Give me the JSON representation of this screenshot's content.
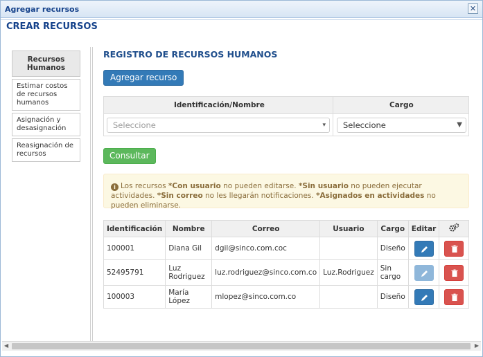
{
  "window": {
    "title": "Agregar recursos",
    "close_glyph": "✕"
  },
  "heading": "CREAR RECURSOS",
  "sidebar": {
    "items": [
      {
        "label": "Recursos Humanos",
        "active": true
      },
      {
        "label": "Estimar costos de recursos humanos",
        "active": false
      },
      {
        "label": "Asignación y desasignación",
        "active": false
      },
      {
        "label": "Reasignación de recursos",
        "active": false
      }
    ]
  },
  "main": {
    "section_title": "REGISTRO DE RECURSOS HUMANOS",
    "add_button": "Agregar recurso",
    "filter": {
      "col_id_name": "Identificación/Nombre",
      "col_cargo": "Cargo",
      "id_select_placeholder": "Seleccione",
      "cargo_select_value": "Seleccione"
    },
    "consult_button": "Consultar",
    "alert": {
      "p1": "Los recursos ",
      "b1": "*Con usuario",
      "p2": " no pueden editarse. ",
      "b2": "*Sin usuario",
      "p3": " no pueden ejecutar actividades. ",
      "b3": "*Sin correo",
      "p4": " no les llegarán notificaciones. ",
      "b4": "*Asignados en actividades",
      "p5": " no pueden eliminarse."
    },
    "table": {
      "headers": {
        "id": "Identificación",
        "name": "Nombre",
        "email": "Correo",
        "user": "Usuario",
        "cargo": "Cargo",
        "edit": "Editar",
        "settings_icon": "gears-icon"
      },
      "rows": [
        {
          "id": "100001",
          "name": "Diana Gil",
          "email": "dgil@sinco.com.coc",
          "user": "",
          "cargo": "Diseño",
          "editable": true
        },
        {
          "id": "52495791",
          "name": "Luz Rodriguez",
          "email": "luz.rodriguez@sinco.com.co",
          "user": "Luz.Rodriguez",
          "cargo": "Sin cargo",
          "editable": false
        },
        {
          "id": "100003",
          "name": "María López",
          "email": "mlopez@sinco.com.co",
          "user": "",
          "cargo": "Diseño",
          "editable": true
        }
      ]
    }
  },
  "colors": {
    "primary": "#337ab7",
    "success": "#5cb85c",
    "danger": "#d9534f",
    "title_blue": "#15428b",
    "alert_bg": "#fcf8e3"
  }
}
